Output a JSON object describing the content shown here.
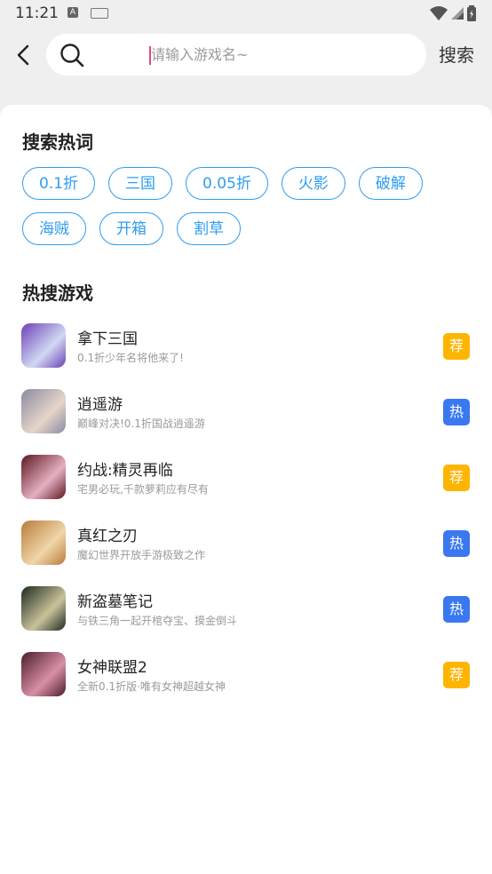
{
  "status": {
    "time": "11:21",
    "a_icon": "A"
  },
  "header": {
    "search_placeholder": "请输入游戏名~",
    "search_value": "",
    "search_button": "搜索"
  },
  "hot_words": {
    "title": "搜索热词",
    "rows": [
      [
        "0.1折",
        "三国",
        "0.05折",
        "火影",
        "破解"
      ],
      [
        "海贼",
        "开箱",
        "割草"
      ]
    ]
  },
  "hot_games": {
    "title": "热搜游戏",
    "items": [
      {
        "name": "拿下三国",
        "desc": "0.1折少年名将他来了!",
        "badge": "荐",
        "badge_color": "#ffb400",
        "thumb_colors": [
          "#6b3fb8",
          "#d2d8f3"
        ]
      },
      {
        "name": "逍遥游",
        "desc": "巅峰对决!0.1折国战逍遥游",
        "badge": "热",
        "badge_color": "#3a78f0",
        "thumb_colors": [
          "#8a8aa2",
          "#e6d5c9"
        ]
      },
      {
        "name": "约战:精灵再临",
        "desc": "宅男必玩,千款萝莉应有尽有",
        "badge": "荐",
        "badge_color": "#ffb400",
        "thumb_colors": [
          "#5b1620",
          "#e6b0c1"
        ]
      },
      {
        "name": "真红之刃",
        "desc": "魔幻世界开放手游极致之作",
        "badge": "热",
        "badge_color": "#3a78f0",
        "thumb_colors": [
          "#b87b3a",
          "#f0d6a8"
        ]
      },
      {
        "name": "新盗墓笔记",
        "desc": "与铁三角一起开棺夺宝、摸金倒斗",
        "badge": "热",
        "badge_color": "#3a78f0",
        "thumb_colors": [
          "#1b2a21",
          "#c9c29a"
        ]
      },
      {
        "name": "女神联盟2",
        "desc": "全新0.1折版·唯有女神超越女神",
        "badge": "荐",
        "badge_color": "#ffb400",
        "thumb_colors": [
          "#4a1d2a",
          "#d88fa4"
        ]
      }
    ]
  }
}
